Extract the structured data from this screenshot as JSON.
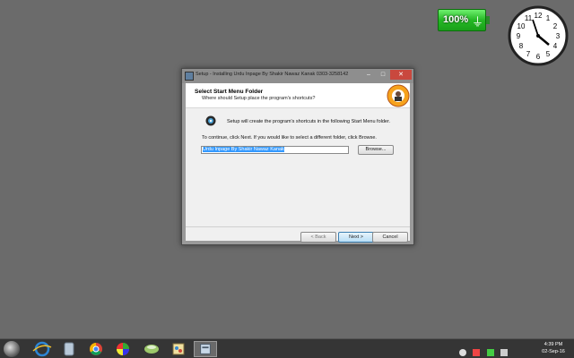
{
  "battery": {
    "percent_label": "100%"
  },
  "clock": {
    "numbers": [
      "12",
      "1",
      "2",
      "3",
      "4",
      "5",
      "6",
      "7",
      "8",
      "9",
      "10",
      "11"
    ]
  },
  "dialog": {
    "title": "Setup - Installing Urdu Inpage By Shakir Nawaz Kanak 0303-3258142",
    "controls": {
      "minimize": "–",
      "maximize": "□",
      "close": "✕"
    },
    "heading": "Select Start Menu Folder",
    "subheading": "Where should Setup place the program's shortcuts?",
    "intro_text": "Setup will create the program's shortcuts in the following Start Menu folder.",
    "continue_text": "To continue, click Next. If you would like to select a different folder, click Browse.",
    "folder_value": "Urdu Inpage By Shakir Nawaz Kanak",
    "browse_label": "Browse...",
    "back_label": "< Back",
    "next_label": "Next >",
    "cancel_label": "Cancel"
  },
  "taskbar": {
    "time": "4:39 PM",
    "date": "02-Sep-16",
    "items": [
      "start-orb",
      "internet-explorer-icon",
      "file-explorer-icon",
      "chrome-icon",
      "media-icon",
      "app-icon",
      "paint-icon",
      "setup-icon"
    ]
  },
  "colors": {
    "accent": "#3399ff",
    "desktop": "#6b6b6b",
    "close": "#c9483e"
  }
}
